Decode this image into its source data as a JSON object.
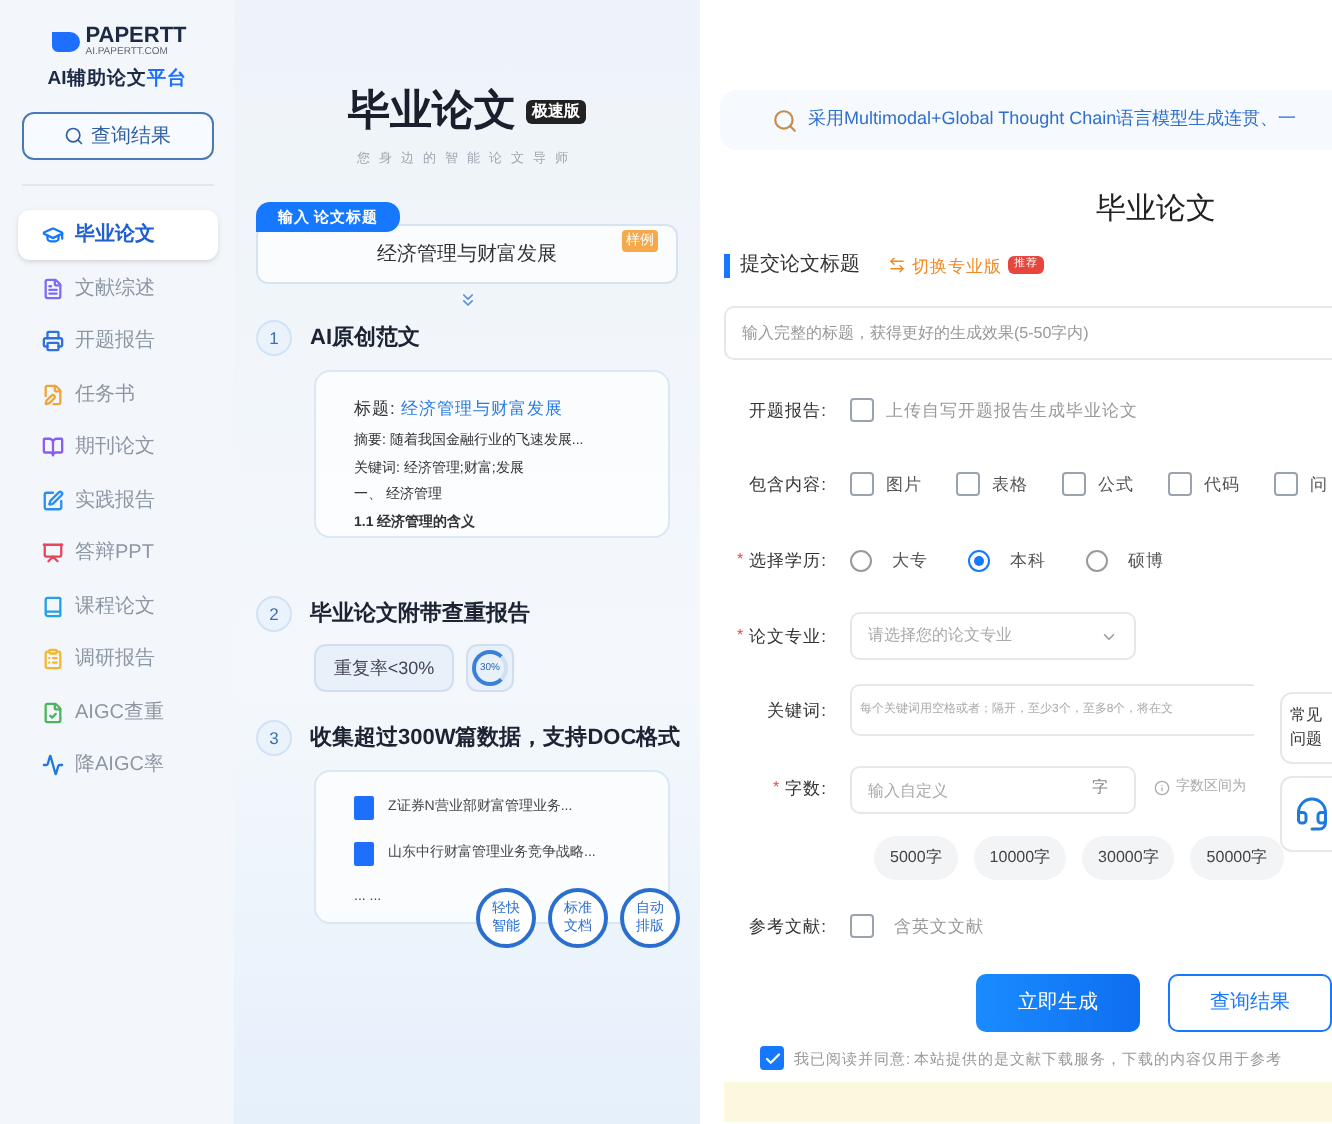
{
  "sidebar": {
    "logo": {
      "name": "PAPERTT",
      "domain": "AI.PAPERTT.COM",
      "tagline": "AI辅助论文",
      "tagline_accent": "平台"
    },
    "query_button": "查询结果",
    "items": [
      {
        "label": "毕业论文",
        "selected": true,
        "color": "#1677ff"
      },
      {
        "label": "文献综述",
        "selected": false,
        "color": "#7b6cf6"
      },
      {
        "label": "开题报告",
        "selected": false,
        "color": "#2f6fe0"
      },
      {
        "label": "任务书",
        "selected": false,
        "color": "#f0a53a"
      },
      {
        "label": "期刊论文",
        "selected": false,
        "color": "#8a5cf0"
      },
      {
        "label": "实践报告",
        "selected": false,
        "color": "#2b8ef0"
      },
      {
        "label": "答辩PPT",
        "selected": false,
        "color": "#e8455f"
      },
      {
        "label": "课程论文",
        "selected": false,
        "color": "#23a0e8"
      },
      {
        "label": "调研报告",
        "selected": false,
        "color": "#f4b62c"
      },
      {
        "label": "AIGC查重",
        "selected": false,
        "color": "#4cb45c"
      },
      {
        "label": "降AIGC率",
        "selected": false,
        "color": "#1f7ae0"
      }
    ]
  },
  "intro": {
    "title": "毕业论文",
    "badge": "极速版",
    "subtitle": "您身边的智能论文导师",
    "input_tab": "输入 论文标题",
    "example_title": "经济管理与财富发展",
    "example_badge": "样例",
    "steps": [
      {
        "number": "1",
        "title": "AI原创范文",
        "kind": "outline",
        "title_label": "标题:",
        "title_value": "经济管理与财富发展",
        "lines": [
          "摘要: 随着我国金融行业的飞速发展...",
          "关键词: 经济管理;财富;发展",
          "一、 经济管理",
          "1.1 经济管理的含义"
        ]
      },
      {
        "number": "2",
        "title": "毕业论文附带查重报告",
        "kind": "report",
        "chip": "重复率<30%",
        "ring": "30%"
      },
      {
        "number": "3",
        "title": "收集超过300W篇数据，支持DOC格式",
        "kind": "documents",
        "docs": [
          "Z证券N营业部财富管理业务...",
          "山东中行财富管理业务竞争战略..."
        ],
        "more": "... ...",
        "features": [
          "轻快智能",
          "标准文档",
          "自动排版"
        ]
      }
    ]
  },
  "form": {
    "banner": "采用Multimodal+Global Thought Chain语言模型生成连贯、一",
    "title": "毕业论文",
    "section": "提交论文标题",
    "switch_link": "切换专业版",
    "switch_badge": "推荐",
    "title_input": {
      "placeholder": "输入完整的标题，获得更好的生成效果(5-50字内)"
    },
    "proposal": {
      "label": "开题报告:",
      "option": "上传自写开题报告生成毕业论文",
      "checked": false
    },
    "contents": {
      "label": "包含内容:",
      "options": [
        {
          "label": "图片",
          "checked": false
        },
        {
          "label": "表格",
          "checked": false
        },
        {
          "label": "公式",
          "checked": false
        },
        {
          "label": "代码",
          "checked": false
        },
        {
          "label": "问",
          "checked": false
        }
      ]
    },
    "degree": {
      "label": "选择学历:",
      "required_mark": "*",
      "options": [
        {
          "label": "大专",
          "selected": false
        },
        {
          "label": "本科",
          "selected": true
        },
        {
          "label": "硕博",
          "selected": false
        }
      ]
    },
    "major": {
      "label": "论文专业:",
      "required_mark": "*",
      "placeholder": "请选择您的论文专业"
    },
    "keywords": {
      "label": "关键词:",
      "placeholder": "每个关键词用空格或者；隔开，至少3个，至多8个，将在文"
    },
    "word_count": {
      "label": "字数:",
      "required_mark": "*",
      "placeholder": "输入自定义",
      "unit": "字",
      "hint": "字数区间为",
      "presets": [
        "5000字",
        "10000字",
        "30000字",
        "50000字"
      ]
    },
    "references": {
      "label": "参考文献:",
      "option": "含英文文献",
      "checked": false
    },
    "generate_button": "立即生成",
    "query_button": "查询结果",
    "agreement": {
      "text": "我已阅读并同意: 本站提供的是文献下载服务，下载的内容仅用于参考",
      "checked": true
    },
    "help_widget": "常见问题"
  }
}
